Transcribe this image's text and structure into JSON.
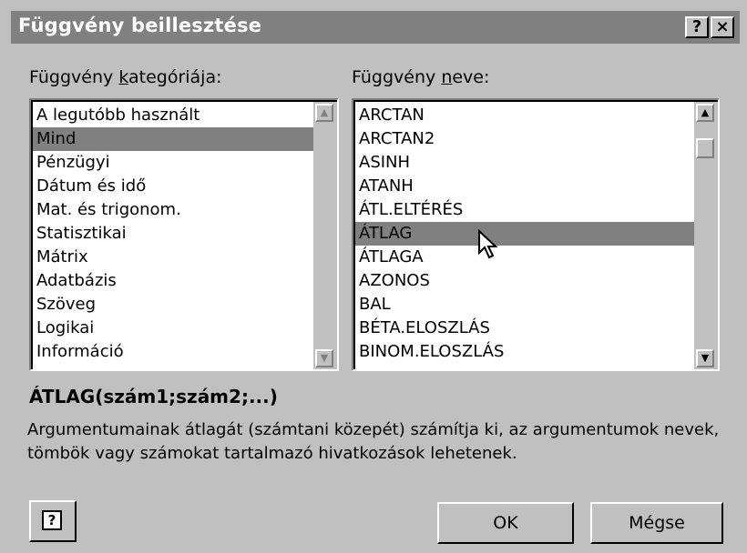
{
  "dialog": {
    "title": "Függvény beillesztése",
    "help_title_button": "?",
    "close_button": "×"
  },
  "category": {
    "label_pre": "Függvény ",
    "label_accel": "k",
    "label_post": "ategóriája:",
    "items": [
      "A legutóbb használt",
      "Mind",
      "Pénzügyi",
      "Dátum és idő",
      "Mat. és trigonom.",
      "Statisztikai",
      "Mátrix",
      "Adatbázis",
      "Szöveg",
      "Logikai",
      "Információ"
    ],
    "selected": "Mind"
  },
  "function_list": {
    "label_pre": "Függvény ",
    "label_accel": "n",
    "label_post": "eve:",
    "items": [
      "ARCTAN",
      "ARCTAN2",
      "ASINH",
      "ATANH",
      "ÁTL.ELTÉRÉS",
      "ÁTLAG",
      "ÁTLAGA",
      "AZONOS",
      "BAL",
      "BÉTA.ELOSZLÁS",
      "BINOM.ELOSZLÁS"
    ],
    "selected": "ÁTLAG"
  },
  "signature": "ÁTLAG(szám1;szám2;...)",
  "description": "Argumentumainak átlagát (számtani közepét) számítja ki, az argumentumok nevek, tömbök vagy számokat tartalmazó hivatkozások lehetenek.",
  "buttons": {
    "ok": "OK",
    "cancel": "Mégse",
    "help_icon": "?"
  }
}
